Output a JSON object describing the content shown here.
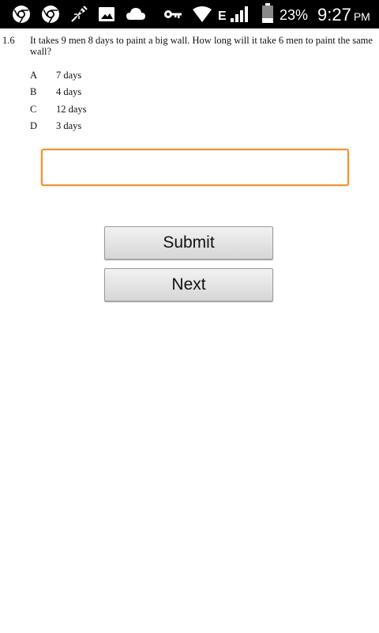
{
  "status_bar": {
    "icons_left": [
      "chrome-icon",
      "chrome-icon",
      "app-icon",
      "image-icon",
      "cloud-icon"
    ],
    "icons_right": [
      "key-icon",
      "wifi-icon",
      "signal-icon",
      "battery-icon"
    ],
    "network_type": "E",
    "battery_percent": "23%",
    "time": "9:27",
    "ampm": "PM"
  },
  "question": {
    "number": "1.6",
    "text": "It takes 9 men 8 days to paint a big wall. How long will it take 6 men to paint the same wall?",
    "options": [
      {
        "letter": "A",
        "text": "7 days"
      },
      {
        "letter": "B",
        "text": "4 days"
      },
      {
        "letter": "C",
        "text": "12 days"
      },
      {
        "letter": "D",
        "text": "3 days"
      }
    ]
  },
  "answer_input": {
    "value": "",
    "placeholder": ""
  },
  "buttons": {
    "submit": "Submit",
    "next": "Next"
  },
  "colors": {
    "input_border": "#f0922e",
    "status_bar_bg": "#000000"
  }
}
